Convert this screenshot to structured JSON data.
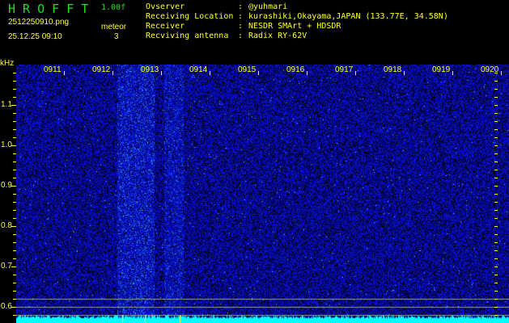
{
  "header": {
    "app_title": "H R O F F T",
    "version": "1.00f",
    "filename": "2512250910.png",
    "datetime": "25.12.25 09:10",
    "meteor_label": "meteor",
    "meteor_count": "3"
  },
  "info": [
    {
      "key": "Ovserver",
      "value": "@yuhmari"
    },
    {
      "key": "Receiving Location",
      "value": "kurashiki,Okayama,JAPAN (133.77E, 34.58N)"
    },
    {
      "key": "Receiver",
      "value": "NESDR SMArt + HDSDR"
    },
    {
      "key": "Recviving antenna",
      "value": "Radix RY-62V"
    }
  ],
  "axis": {
    "unit": "kHz",
    "freq_labels": [
      "1.1",
      "1.0",
      "0.9",
      "0.8",
      "0.7",
      "0.6"
    ],
    "time_labels": [
      "0911",
      "0912",
      "0913",
      "0914",
      "0915",
      "0916",
      "0917",
      "0918",
      "0919",
      "0920"
    ]
  },
  "colors": {
    "background": "#000000",
    "text": "#ffff33",
    "title": "#22dd22",
    "noise": "#0a1a9a",
    "baseline": "#00ffff"
  }
}
